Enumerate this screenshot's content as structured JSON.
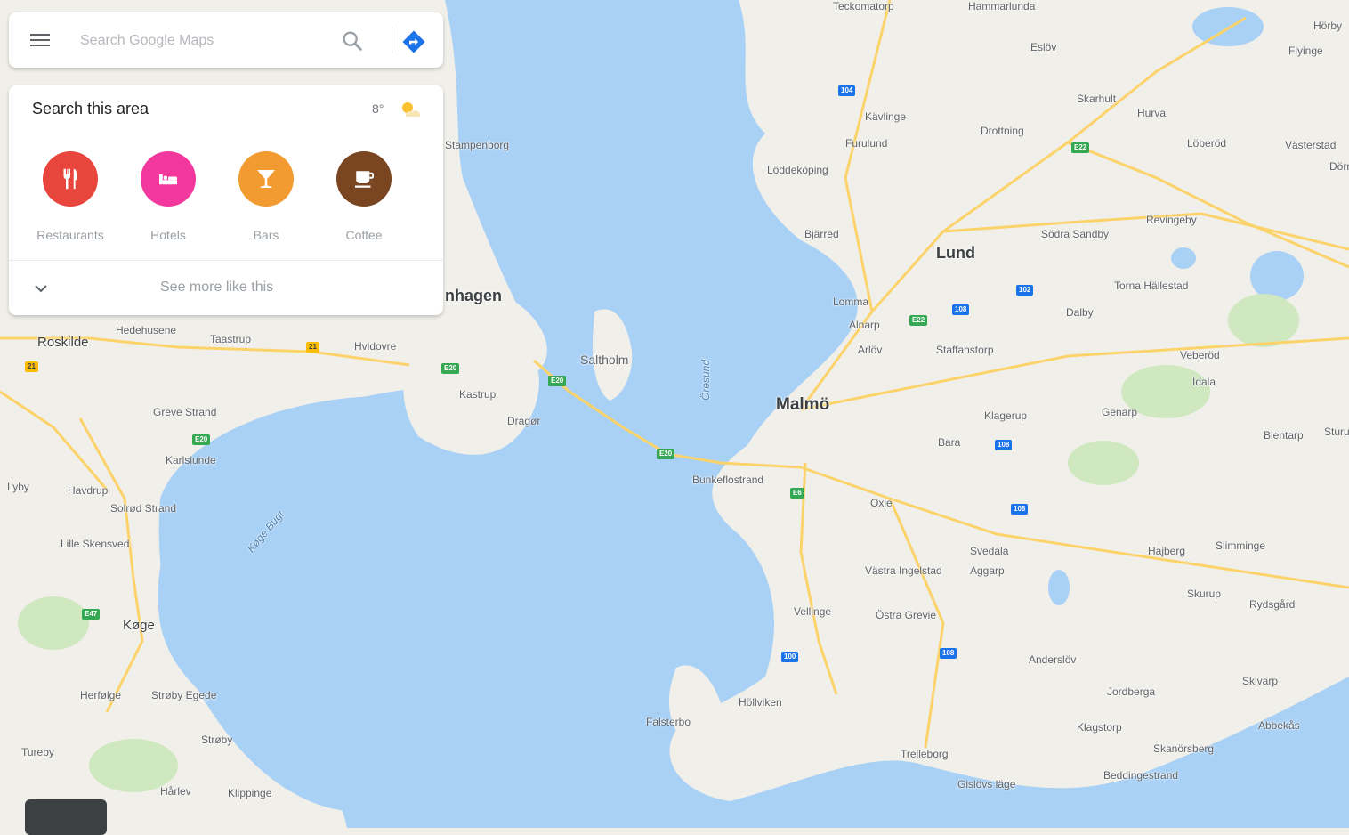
{
  "search": {
    "placeholder": "Search Google Maps",
    "value": ""
  },
  "area_panel": {
    "title": "Search this area",
    "temperature": "8°",
    "categories": [
      {
        "label": "Restaurants",
        "icon": "restaurant-icon",
        "color": "#ea4335"
      },
      {
        "label": "Hotels",
        "icon": "hotel-icon",
        "color": "#f2389c"
      },
      {
        "label": "Bars",
        "icon": "bar-icon",
        "color": "#f29b30"
      },
      {
        "label": "Coffee",
        "icon": "coffee-icon",
        "color": "#7a4621"
      }
    ],
    "see_more": "See more like this"
  },
  "colors": {
    "water": "#a9d1f6",
    "land": "#f1efe9",
    "road": "#fcd36b",
    "park": "#cfe8c0",
    "directions": "#1a73e8"
  },
  "map_labels": {
    "cities": [
      "Malmö",
      "Lund",
      "Køge",
      "Roskilde",
      "nhagen"
    ],
    "towns": [
      "Saltholm",
      "Kastrup",
      "Dragør",
      "Kävlinge",
      "Löddeköping",
      "Bjärred",
      "Lomma",
      "Alnarp",
      "Arlöv",
      "Staffanstorp",
      "Dalby",
      "Veberöd",
      "Södra Sandby",
      "Revingeby",
      "Torna Hällestad",
      "Genarp",
      "Bara",
      "Klagerup",
      "Svedala",
      "Oxie",
      "Västra Ingelstad",
      "Östra Grevie",
      "Vellinge",
      "Höllviken",
      "Falsterbo",
      "Trelleborg",
      "Anderslöv",
      "Skurup",
      "Rydsgård",
      "Jordberga",
      "Klagstorp",
      "Skivarp",
      "Abbekås",
      "Beddingestrand",
      "Gislövs läge",
      "Hajberg",
      "Slimminge",
      "Skanörsberg",
      "Hvidovre",
      "Taastrup",
      "Hedehusene",
      "Greve Strand",
      "Karlslunde",
      "Solrød Strand",
      "Havdrup",
      "Lille Skensved",
      "Herfølge",
      "Strøby Egede",
      "Strøby",
      "Hårlev",
      "Klippinge",
      "Tureby",
      "Furulund",
      "Flyinge",
      "Eslöv",
      "Skarhult",
      "Hurva",
      "Löberöd",
      "Västerstad",
      "Dörröd",
      "Idala",
      "Blentarp",
      "Sturup",
      "Aggarp",
      "Bunkeflostrand",
      "Drottning",
      "Lyby",
      "Hörby",
      "Öresund",
      "Køge Bugt",
      "Teckomatorp",
      "Hammarlunda",
      "Stampenborg"
    ]
  }
}
